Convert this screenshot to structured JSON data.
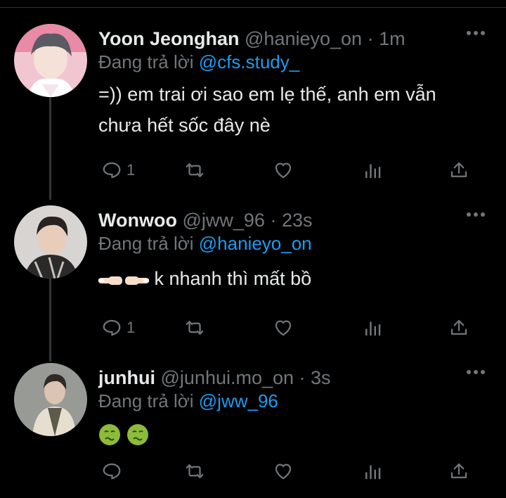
{
  "tweets": [
    {
      "name": "Yoon Jeonghan",
      "handle": "@hanieyo_on",
      "time": "· 1m",
      "replying_prefix": "Đang trả lời ",
      "replying_to": "@cfs.study_",
      "text_line1": "=)) em trai ơi sao em lẹ thế, anh em vẫn",
      "text_line2": "chưa hết sốc đây nè",
      "reply_count": "1"
    },
    {
      "name": "Wonwoo",
      "handle": "@jww_96",
      "time": "· 23s",
      "replying_prefix": "Đang trả lời ",
      "replying_to": "@hanieyo_on",
      "text": "k nhanh thì mất bồ",
      "reply_count": "1"
    },
    {
      "name": "junhui",
      "handle": "@junhui.mo_on",
      "time": "· 3s",
      "replying_prefix": "Đang trả lời ",
      "replying_to": "@jww_96",
      "reply_count": ""
    }
  ],
  "icons": {
    "reply": "reply-icon",
    "retweet": "retweet-icon",
    "like": "heart-icon",
    "views": "views-icon",
    "share": "share-icon",
    "more": "more-icon"
  },
  "colors": {
    "background": "#000000",
    "text": "#e7e9ea",
    "muted": "#71767b",
    "mention": "#1d9bf0",
    "thread_line": "#333639"
  }
}
